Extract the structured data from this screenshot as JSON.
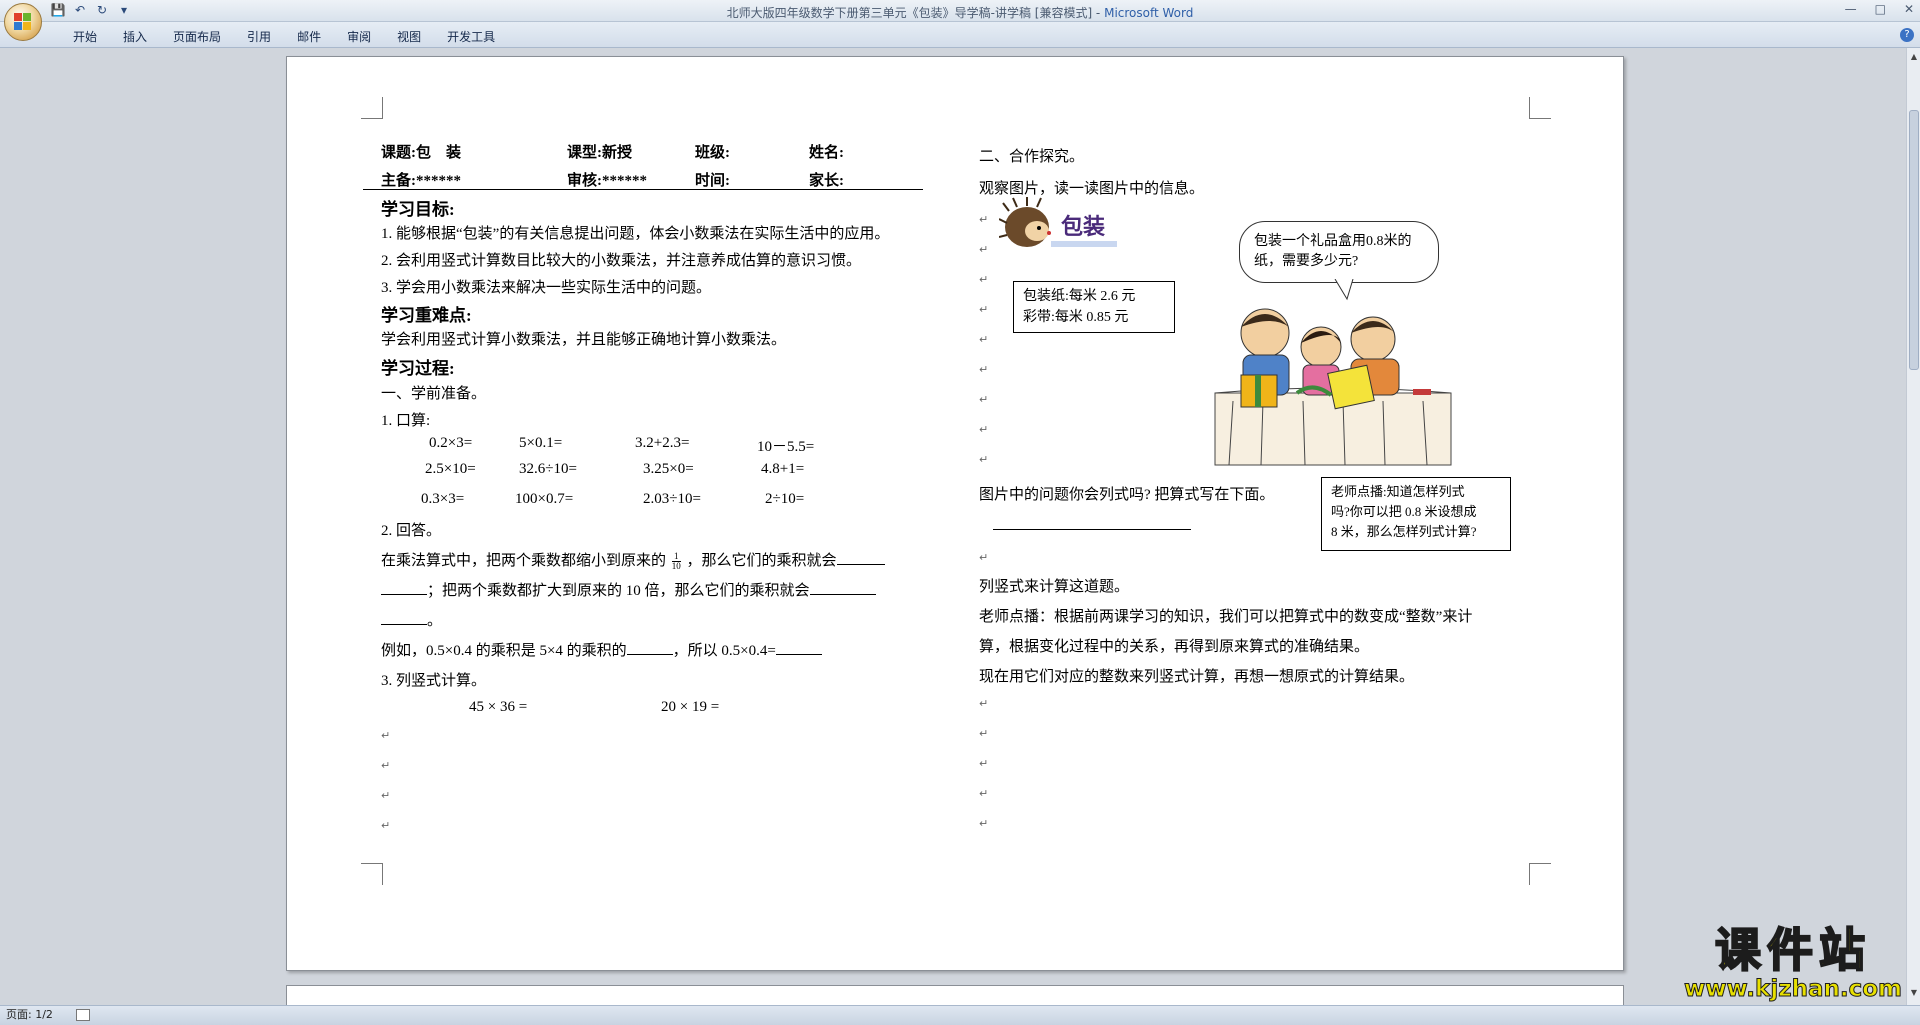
{
  "window": {
    "title": "北师大版四年级数学下册第三单元《包装》导学稿-讲学稿 [兼容模式] - ",
    "app_name": "Microsoft Word",
    "help": "?"
  },
  "ribbon_tabs": [
    "开始",
    "插入",
    "页面布局",
    "引用",
    "邮件",
    "审阅",
    "视图",
    "开发工具"
  ],
  "status": {
    "page": "页面: 1/2"
  },
  "doc": {
    "header": {
      "topic_label": "课题:包　装",
      "type_label": "课型:新授",
      "class_label": "班级:",
      "name_label": "姓名:",
      "author_label": "主备:******",
      "review_label": "审核:******",
      "time_label": "时间:",
      "parent_label": "家长:"
    },
    "goals_title": "学习目标:",
    "goals": [
      "1. 能够根据“包装”的有关信息提出问题，体会小数乘法在实际生活中的应用。",
      "2. 会利用竖式计算数目比较大的小数乘法，并注意养成估算的意识习惯。",
      "3. 学会用小数乘法来解决一些实际生活中的问题。"
    ],
    "key_title": "学习重难点:",
    "key_text": "学会利用竖式计算小数乘法，并且能够正确地计算小数乘法。",
    "process_title": "学习过程:",
    "prep_title": "一、学前准备。",
    "oral_title": "1. 口算:",
    "oral_row1": [
      "0.2×3=",
      "5×0.1=",
      "3.2+2.3=",
      "10－5.5="
    ],
    "oral_row2": [
      "2.5×10=",
      "32.6÷10=",
      "3.25×0=",
      "4.8+1="
    ],
    "oral_row3": [
      "0.3×3=",
      "100×0.7=",
      "2.03÷10=",
      "2÷10="
    ],
    "answer_title": "2. 回答。",
    "answer_line1a": "在乘法算式中，把两个乘数都缩小到原来的",
    "fraction_num": "1",
    "fraction_den": "10",
    "answer_line1b": "，那么它们的乘积就会",
    "answer_line2": "；把两个乘数都扩大到原来的 10 倍，那么它们的乘积就会",
    "answer_line3": "。",
    "example_text_a": "例如，0.5×0.4 的乘积是 5×4 的乘积的",
    "example_text_b": "，所以 0.5×0.4=",
    "vertical_title": "3. 列竖式计算。",
    "vertical_q1": "45 × 36 =",
    "vertical_q2": "20 × 19 =",
    "coop_title": "二、合作探究。",
    "observe_text": "观察图片，读一读图片中的信息。",
    "package_logo": "包装",
    "bubble_text": "包装一个礼品盒用0.8米的纸，需要多少元?",
    "price_box": [
      "包装纸:每米 2.6 元",
      "彩带:每米 0.85 元"
    ],
    "question_text": "图片中的问题你会列式吗? 把算式写在下面。",
    "teacher_box": [
      "老师点播:知道怎样列式",
      "吗?你可以把 0.8 米设想成",
      "8 米，那么怎样列式计算?"
    ],
    "vertical_solve": "列竖式来计算这道题。",
    "teacher_hint1": "老师点播：根据前两课学习的知识，我们可以把算式中的数变成“整数”来计",
    "teacher_hint2": "算，根据变化过程中的关系，再得到原来算式的准确结果。",
    "integer_text": "现在用它们对应的整数来列竖式计算，再想一想原式的计算结果。",
    "return_mark": "↵"
  },
  "watermark": {
    "cn": "课件站",
    "url": "www.kjzhan.com"
  }
}
